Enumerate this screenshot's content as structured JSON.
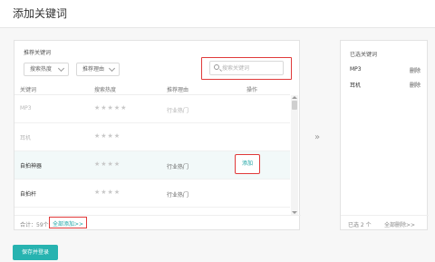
{
  "page": {
    "title": "添加关键词"
  },
  "left": {
    "section_title": "推荐关键词",
    "filters": [
      "搜索热度",
      "推荐理由"
    ],
    "search": {
      "placeholder": "搜索关键词"
    },
    "columns": [
      "关键词",
      "搜索热度",
      "推荐理由",
      "操作"
    ],
    "rows": [
      {
        "keyword": "MP3",
        "stars": "★★★★★",
        "reason": "行业热门",
        "action": ""
      },
      {
        "keyword": "耳机",
        "stars": "★★★★",
        "reason": "",
        "action": ""
      },
      {
        "keyword": "自拍神器",
        "stars": "★★★★",
        "reason": "行业热门",
        "action": "添加"
      },
      {
        "keyword": "自拍杆",
        "stars": "★★★★",
        "reason": "行业热门",
        "action": ""
      }
    ],
    "total": "合计：59个",
    "add_all": "全部添加>>"
  },
  "transfer_icon": "»",
  "right": {
    "title": "已选关键词",
    "items": [
      {
        "keyword": "MP3",
        "action": "删除"
      },
      {
        "keyword": "耳机",
        "action": "删除"
      }
    ],
    "count": "已选 2 个",
    "delete_all": "全部删除>>"
  },
  "actions": {
    "save": "保存并登录"
  },
  "colors": {
    "accent": "#27b3b0",
    "highlight_border": "#e03a3a",
    "link": "#1aa3a3"
  }
}
